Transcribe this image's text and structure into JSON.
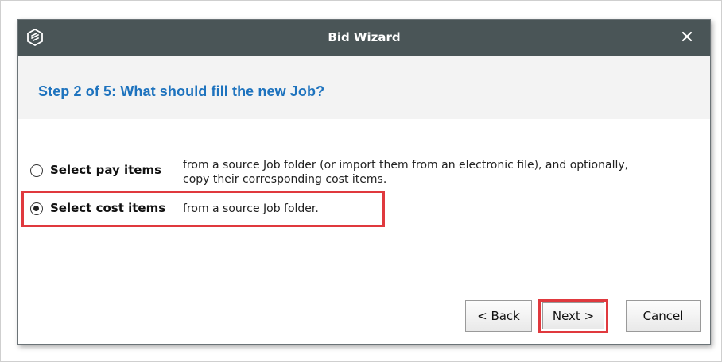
{
  "window": {
    "title": "Bid Wizard",
    "title_bar_color": "#4a5557",
    "icon": "app-logo-icon",
    "close_icon": "close-icon"
  },
  "step": {
    "title": "Step 2 of 5: What should fill the new Job?",
    "title_color": "#1e73be"
  },
  "options": [
    {
      "label": "Select pay items",
      "description_line1": "from a source Job folder (or import them from an electronic file), and optionally,",
      "description_line2": "copy their corresponding cost items.",
      "selected": false
    },
    {
      "label": "Select cost items",
      "description_line1": "from a source Job folder.",
      "selected": true
    }
  ],
  "highlight_color": "#e0393e",
  "buttons": {
    "back": "< Back",
    "next": "Next >",
    "cancel": "Cancel"
  }
}
